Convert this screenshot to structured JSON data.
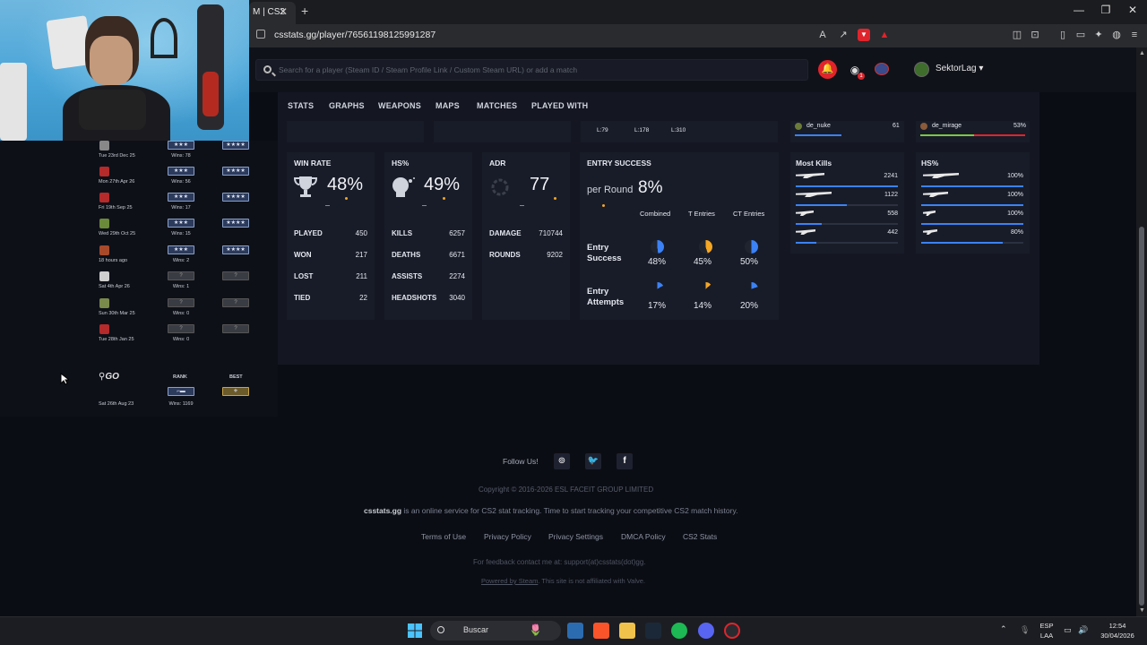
{
  "browser": {
    "tab_title": "M | CS2",
    "url": "csstats.gg/player/76561198125991287"
  },
  "header": {
    "search_placeholder": "Search for a player (Steam ID / Steam Profile Link / Custom Steam URL) or add a match",
    "username": "SektorLag",
    "discord_badge": "1"
  },
  "nav": [
    "STATS",
    "GRAPHS",
    "WEAPONS",
    "MAPS",
    "MATCHES",
    "PLAYED WITH"
  ],
  "top_fragment": {
    "l79": "L:79",
    "l178": "L:178",
    "l310": "L:310",
    "map1_name": "de_nuke",
    "map1_value": "61",
    "map2_name": "de_mirage",
    "map2_value": "53%"
  },
  "win_rate": {
    "title": "WIN RATE",
    "value": "48%",
    "rows": [
      {
        "label": "PLAYED",
        "value": "450"
      },
      {
        "label": "WON",
        "value": "217"
      },
      {
        "label": "LOST",
        "value": "211"
      },
      {
        "label": "TIED",
        "value": "22"
      }
    ]
  },
  "hs": {
    "title": "HS%",
    "value": "49%",
    "rows": [
      {
        "label": "KILLS",
        "value": "6257"
      },
      {
        "label": "DEATHS",
        "value": "6671"
      },
      {
        "label": "ASSISTS",
        "value": "2274"
      },
      {
        "label": "HEADSHOTS",
        "value": "3040"
      }
    ]
  },
  "adr": {
    "title": "ADR",
    "value": "77",
    "rows": [
      {
        "label": "DAMAGE",
        "value": "710744"
      },
      {
        "label": "ROUNDS",
        "value": "9202"
      }
    ]
  },
  "entry": {
    "title": "ENTRY SUCCESS",
    "per_round_label": "per Round",
    "per_round_value": "8%",
    "columns": [
      "Combined",
      "T Entries",
      "CT Entries"
    ],
    "success_label": "Entry Success",
    "success_values": [
      "48%",
      "45%",
      "50%"
    ],
    "success_fractions": [
      0.48,
      0.45,
      0.5
    ],
    "attempts_label": "Entry Attempts",
    "attempts_values": [
      "17%",
      "14%",
      "20%"
    ],
    "attempts_fractions": [
      0.17,
      0.14,
      0.2
    ]
  },
  "most_kills": {
    "title": "Most Kills",
    "values": [
      "2241",
      "1122",
      "558",
      "442"
    ],
    "fractions": [
      1.0,
      0.5,
      0.25,
      0.2
    ]
  },
  "weapons_hs": {
    "title": "HS%",
    "values": [
      "100%",
      "100%",
      "100%",
      "80%"
    ],
    "fractions": [
      1.0,
      1.0,
      1.0,
      0.8
    ]
  },
  "ranks": [
    {
      "date": "Tue 23rd Dec 25",
      "wins": "Wins: 78"
    },
    {
      "date": "Mon 27th Apr 26",
      "wins": "Wins: 56"
    },
    {
      "date": "Fri 19th Sep 25",
      "wins": "Wins: 17"
    },
    {
      "date": "Wed 29th Oct 25",
      "wins": "Wins: 15"
    },
    {
      "date": "18 hours ago",
      "wins": "Wins: 2"
    },
    {
      "date": "Sat 4th Apr 26",
      "wins": "Wins: 1"
    },
    {
      "date": "Sun 30th Mar 25",
      "wins": "Wins: 0"
    },
    {
      "date": "Tue 28th Jan 25",
      "wins": "Wins: 0"
    }
  ],
  "csgo": {
    "logo": "GO",
    "rank_header": "RANK",
    "best_header": "BEST",
    "date": "Sat 26th Aug 23",
    "wins": "Wins: 1169"
  },
  "footer": {
    "follow": "Follow Us!",
    "copyright": "Copyright © 2016-2026 ESL FACEIT GROUP LIMITED",
    "brand": "csstats.gg",
    "tagline": " is an online service for CS2 stat tracking. Time to start tracking your competitive CS2 match history.",
    "links": [
      "Terms of Use",
      "Privacy Policy",
      "Privacy Settings",
      "DMCA Policy",
      "CS2 Stats"
    ],
    "feedback": "For feedback contact me at: support(at)csstats(dot)gg.",
    "powered": "Powered by Steam",
    "disclaimer": ". This site is not affiliated with Valve."
  },
  "taskbar": {
    "search_label": "Buscar",
    "lang1": "ESP",
    "lang2": "LAA",
    "time": "12:54",
    "date": "30/04/2026"
  },
  "colors": {
    "blue": "#3b82f6",
    "orange": "#f5a623",
    "red": "#e0242b",
    "green": "#7ac943"
  }
}
